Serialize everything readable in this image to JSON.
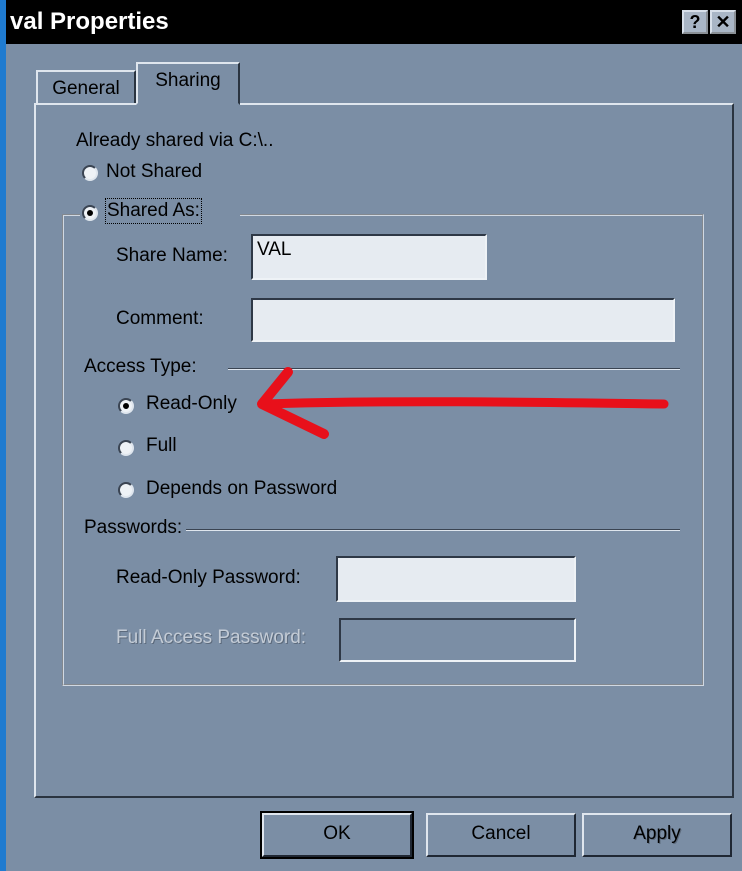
{
  "window": {
    "title": "val Properties"
  },
  "titlebar_buttons": {
    "help": "?",
    "close": "✕"
  },
  "tabs": [
    {
      "label": "General"
    },
    {
      "label": "Sharing"
    }
  ],
  "sharing": {
    "already_shared": "Already shared via C:\\..",
    "not_shared": "Not Shared",
    "shared_as": "Shared As:",
    "share_name_label": "Share Name:",
    "share_name_value": "VAL",
    "comment_label": "Comment:",
    "comment_value": "",
    "access_type_label": "Access Type:",
    "access_read_only": "Read-Only",
    "access_full": "Full",
    "access_depends": "Depends on Password",
    "passwords_label": "Passwords:",
    "read_only_password_label": "Read-Only Password:",
    "read_only_password_value": "",
    "full_access_password_label": "Full Access Password:",
    "full_access_password_value": ""
  },
  "buttons": {
    "ok": "OK",
    "cancel": "Cancel",
    "apply": "Apply"
  },
  "colors": {
    "dialog_bg": "#7b8ea5",
    "titlebar": "#000000",
    "annotation_arrow": "#e8101a"
  }
}
